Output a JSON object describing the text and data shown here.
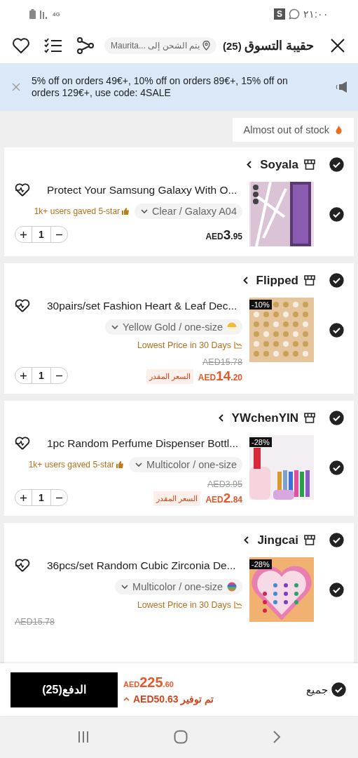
{
  "status_bar": {
    "network": "4G",
    "app_badge": "S",
    "time": "٢١:٠٠"
  },
  "header": {
    "title": "حقيبة التسوق",
    "count": "(25)",
    "ship_to": "يتم الشحن إلى ...Maurita"
  },
  "banner": {
    "text": "5% off on orders 49€+, 10% off on orders 89€+, 15% off on orders 129€+, use code: 4SALE"
  },
  "filter_chip": {
    "label": "Almost out of stock"
  },
  "stores": [
    {
      "name": "Soyala",
      "checked": true,
      "items": [
        {
          "title": "Protect Your Samsung Galaxy With O...",
          "checked": true,
          "rating": "1k+ users gaved 5-star",
          "variant": "Clear / Galaxy A04",
          "price": {
            "currency": "AED",
            "whole": "3",
            "fraction": ".95"
          },
          "discounted": false,
          "quantity": "1"
        }
      ]
    },
    {
      "name": "Flipped",
      "checked": true,
      "items": [
        {
          "title": "30pairs/set Fashion Heart & Leaf Dec...",
          "checked": true,
          "badge": "-10%",
          "variant": "Yellow Gold / one-size",
          "lowest_price": "Lowest Price in 30 Days",
          "old_price": "AED15.78",
          "price_note": "السعر المقدر",
          "price": {
            "currency": "AED",
            "whole": "14",
            "fraction": ".20"
          },
          "discounted": true,
          "quantity": "1"
        }
      ]
    },
    {
      "name": "YWchenYIN",
      "checked": true,
      "items": [
        {
          "title": "1pc Random Perfume Dispenser Bottl...",
          "checked": true,
          "badge": "-28%",
          "rating": "1k+ users gaved 5-star",
          "variant": "Multicolor / one-size",
          "old_price": "AED3.95",
          "price_note": "السعر المقدر",
          "price": {
            "currency": "AED",
            "whole": "2",
            "fraction": ".84"
          },
          "discounted": true,
          "quantity": "1"
        }
      ]
    },
    {
      "name": "Jingcai",
      "checked": true,
      "items": [
        {
          "title": "36pcs/set Random Cubic Zirconia De...",
          "checked": true,
          "badge": "-28%",
          "variant": "Multicolor / one-size",
          "lowest_price": "Lowest Price in 30 Days",
          "old_price": "AED15.78"
        }
      ]
    }
  ],
  "checkout": {
    "select_all": "جميع",
    "checked": true,
    "total": {
      "currency": "AED",
      "whole": "225",
      "fraction": ".60"
    },
    "savings": "تم توفير AED50.63",
    "pay": "الدفع(25)"
  }
}
